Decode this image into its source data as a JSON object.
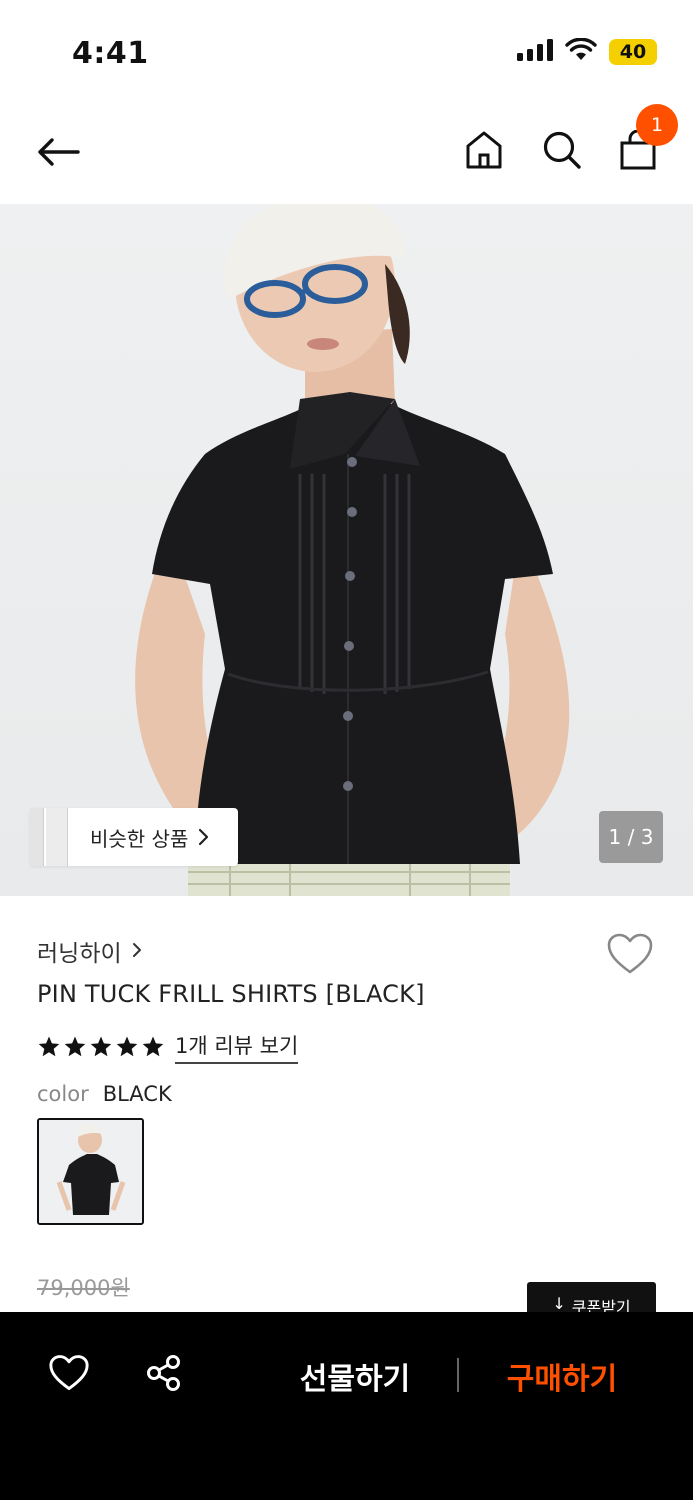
{
  "status_bar": {
    "time": "4:41",
    "battery": "40"
  },
  "header": {
    "cart_count": "1"
  },
  "gallery": {
    "similar_label": "비슷한 상품",
    "page_counter": "1 / 3"
  },
  "product": {
    "brand": "러닝하이",
    "title": "PIN TUCK FRILL SHIRTS [BLACK]",
    "rating_stars": 5,
    "review_link": "1개 리뷰 보기",
    "color_label": "color",
    "color_value": "BLACK",
    "original_price": "79,000원",
    "coupon_label": "쿠폰받기"
  },
  "bottom_bar": {
    "gift_label": "선물하기",
    "buy_label": "구매하기"
  },
  "colors": {
    "accent": "#ff5000",
    "battery": "#f5d000",
    "bottom_bar": "#000000"
  },
  "icons": {
    "back": "arrow-left-icon",
    "home": "home-icon",
    "search": "search-icon",
    "bag": "shopping-bag-icon",
    "wishlist": "heart-icon",
    "share": "share-icon",
    "star": "star-icon"
  }
}
